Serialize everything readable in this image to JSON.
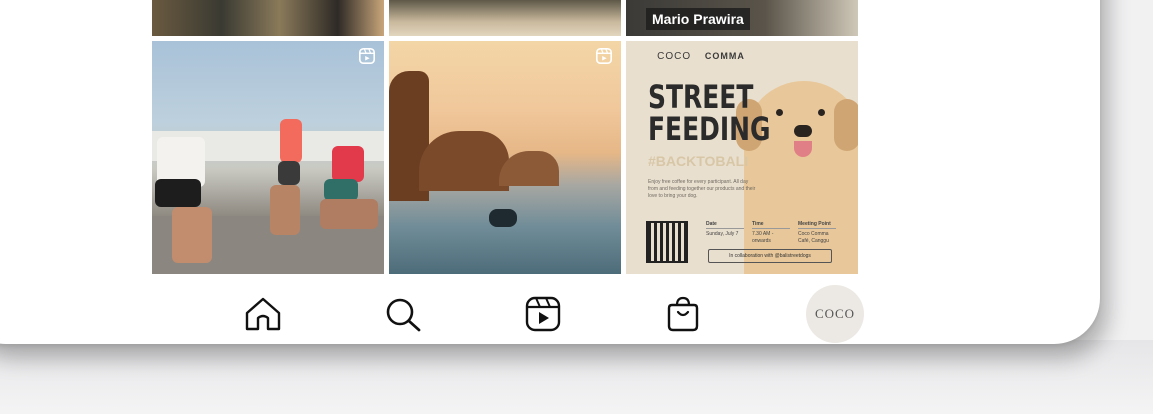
{
  "grid": {
    "top_row": {
      "name_chip": "Mario Prawira"
    },
    "ad": {
      "brand_left": "COCO",
      "brand_right": "COMMA",
      "headline": "STREET FEEDING",
      "hashtag": "#BACKTOBALI",
      "description": "Enjoy free coffee for every participant. All day from and feeding together our products and their love to bring your dog.",
      "info": [
        {
          "heading": "Date",
          "value": "Sunday, July 7"
        },
        {
          "heading": "Time",
          "value": "7.30 AM - onwards"
        },
        {
          "heading": "Meeting Point",
          "value": "Coco Comma Café, Canggu"
        }
      ],
      "collab": "In collaboration with @balistreetdogs"
    }
  },
  "nav": {
    "avatar_label": "COCO",
    "icons": [
      "home-icon",
      "search-icon",
      "reels-icon",
      "shop-bag-icon"
    ]
  }
}
